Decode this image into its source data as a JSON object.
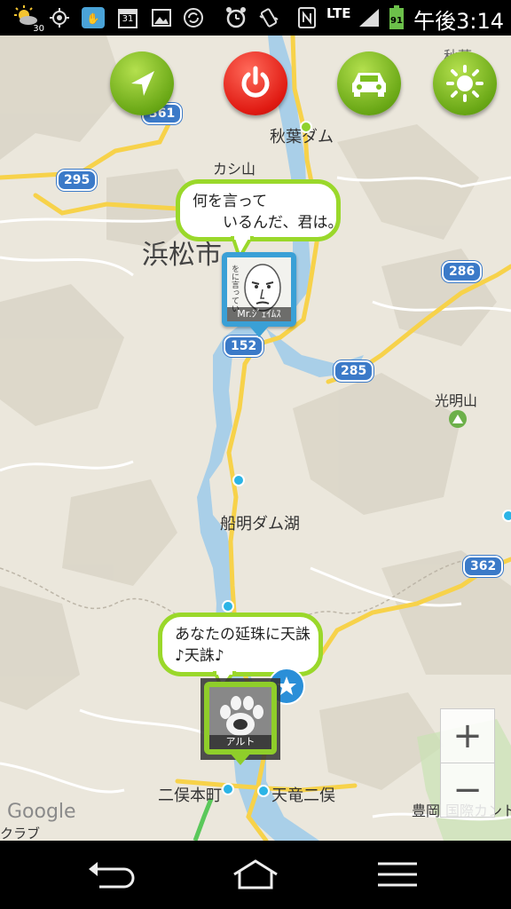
{
  "status_bar": {
    "time": "午後3:14",
    "network": "LTE",
    "battery": "91",
    "weather_temp": "30",
    "calendar_day": "31",
    "icons": [
      "weather-icon",
      "gps-icon",
      "hand-app-icon",
      "calendar-icon",
      "gallery-icon",
      "sync-icon",
      "alarm-icon",
      "vibrate-icon",
      "nfc-icon",
      "lte-icon",
      "signal-icon",
      "battery-icon"
    ]
  },
  "toolbar": {
    "buttons": [
      {
        "name": "navigate-button",
        "icon": "navigation-arrow-icon",
        "color": "#7cbf1f"
      },
      {
        "name": "power-button",
        "icon": "power-icon",
        "color": "#e4251b"
      },
      {
        "name": "car-button",
        "icon": "car-icon",
        "color": "#7cbf1f"
      },
      {
        "name": "brightness-button",
        "icon": "sun-icon",
        "color": "#7cbf1f"
      }
    ]
  },
  "map": {
    "labels": {
      "akiha_dam": "秋葉ダム",
      "kashiyama": "カシ山",
      "hamamatsu": "浜松市",
      "komyozan": "光明山",
      "funagira": "船明ダム湖",
      "futamata_honmachi": "二俣本町",
      "tenryu_futamata": "天竜二俣",
      "toyooka": "豊岡",
      "kokusai": "国際カント",
      "google": "Google",
      "club": "クラブ",
      "akiba_top": "秋葉"
    },
    "route_shields": [
      "361",
      "295",
      "286",
      "152",
      "285",
      "362"
    ],
    "bubbles": {
      "top_text": "何を言って\n　　いるんだ、君は。",
      "bottom_text": "あなたの延珠に天誅\n♪天誅♪"
    },
    "markers": {
      "top_caption": "Mr.ｼﾞｪｲﾑｽ",
      "top_side_text": "をに言ってい",
      "bottom_caption": "アルト"
    },
    "zoom": {
      "in_label": "+",
      "out_label": "−"
    }
  },
  "nav_bar": {
    "buttons": [
      "back-icon",
      "home-icon",
      "menu-icon"
    ]
  }
}
